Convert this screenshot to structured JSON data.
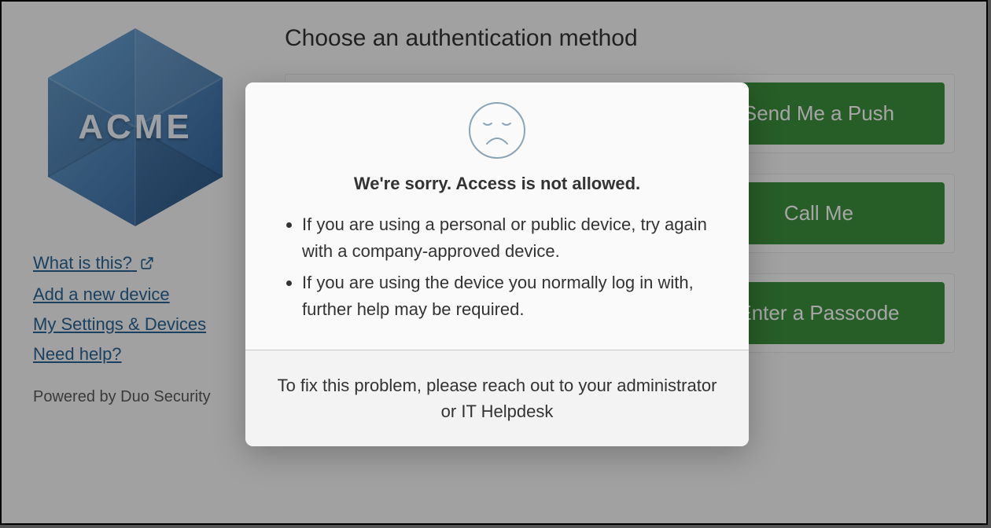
{
  "sidebar": {
    "logo_text": "ACME",
    "links": {
      "what": "What is this?",
      "add_device": "Add a new device",
      "settings": "My Settings & Devices",
      "help": "Need help?"
    },
    "powered": "Powered by Duo Security"
  },
  "main": {
    "heading": "Choose an authentication method",
    "buttons": {
      "push": "Send Me a Push",
      "call": "Call Me",
      "passcode": "Enter a Passcode"
    }
  },
  "modal": {
    "title": "We're sorry. Access is not allowed.",
    "bullets": [
      "If you are using a personal or public device, try again with a company-approved device.",
      "If you are using the device you normally log in with, further help may be required."
    ],
    "footer": "To fix this problem, please reach out to your administrator or IT Helpdesk"
  }
}
